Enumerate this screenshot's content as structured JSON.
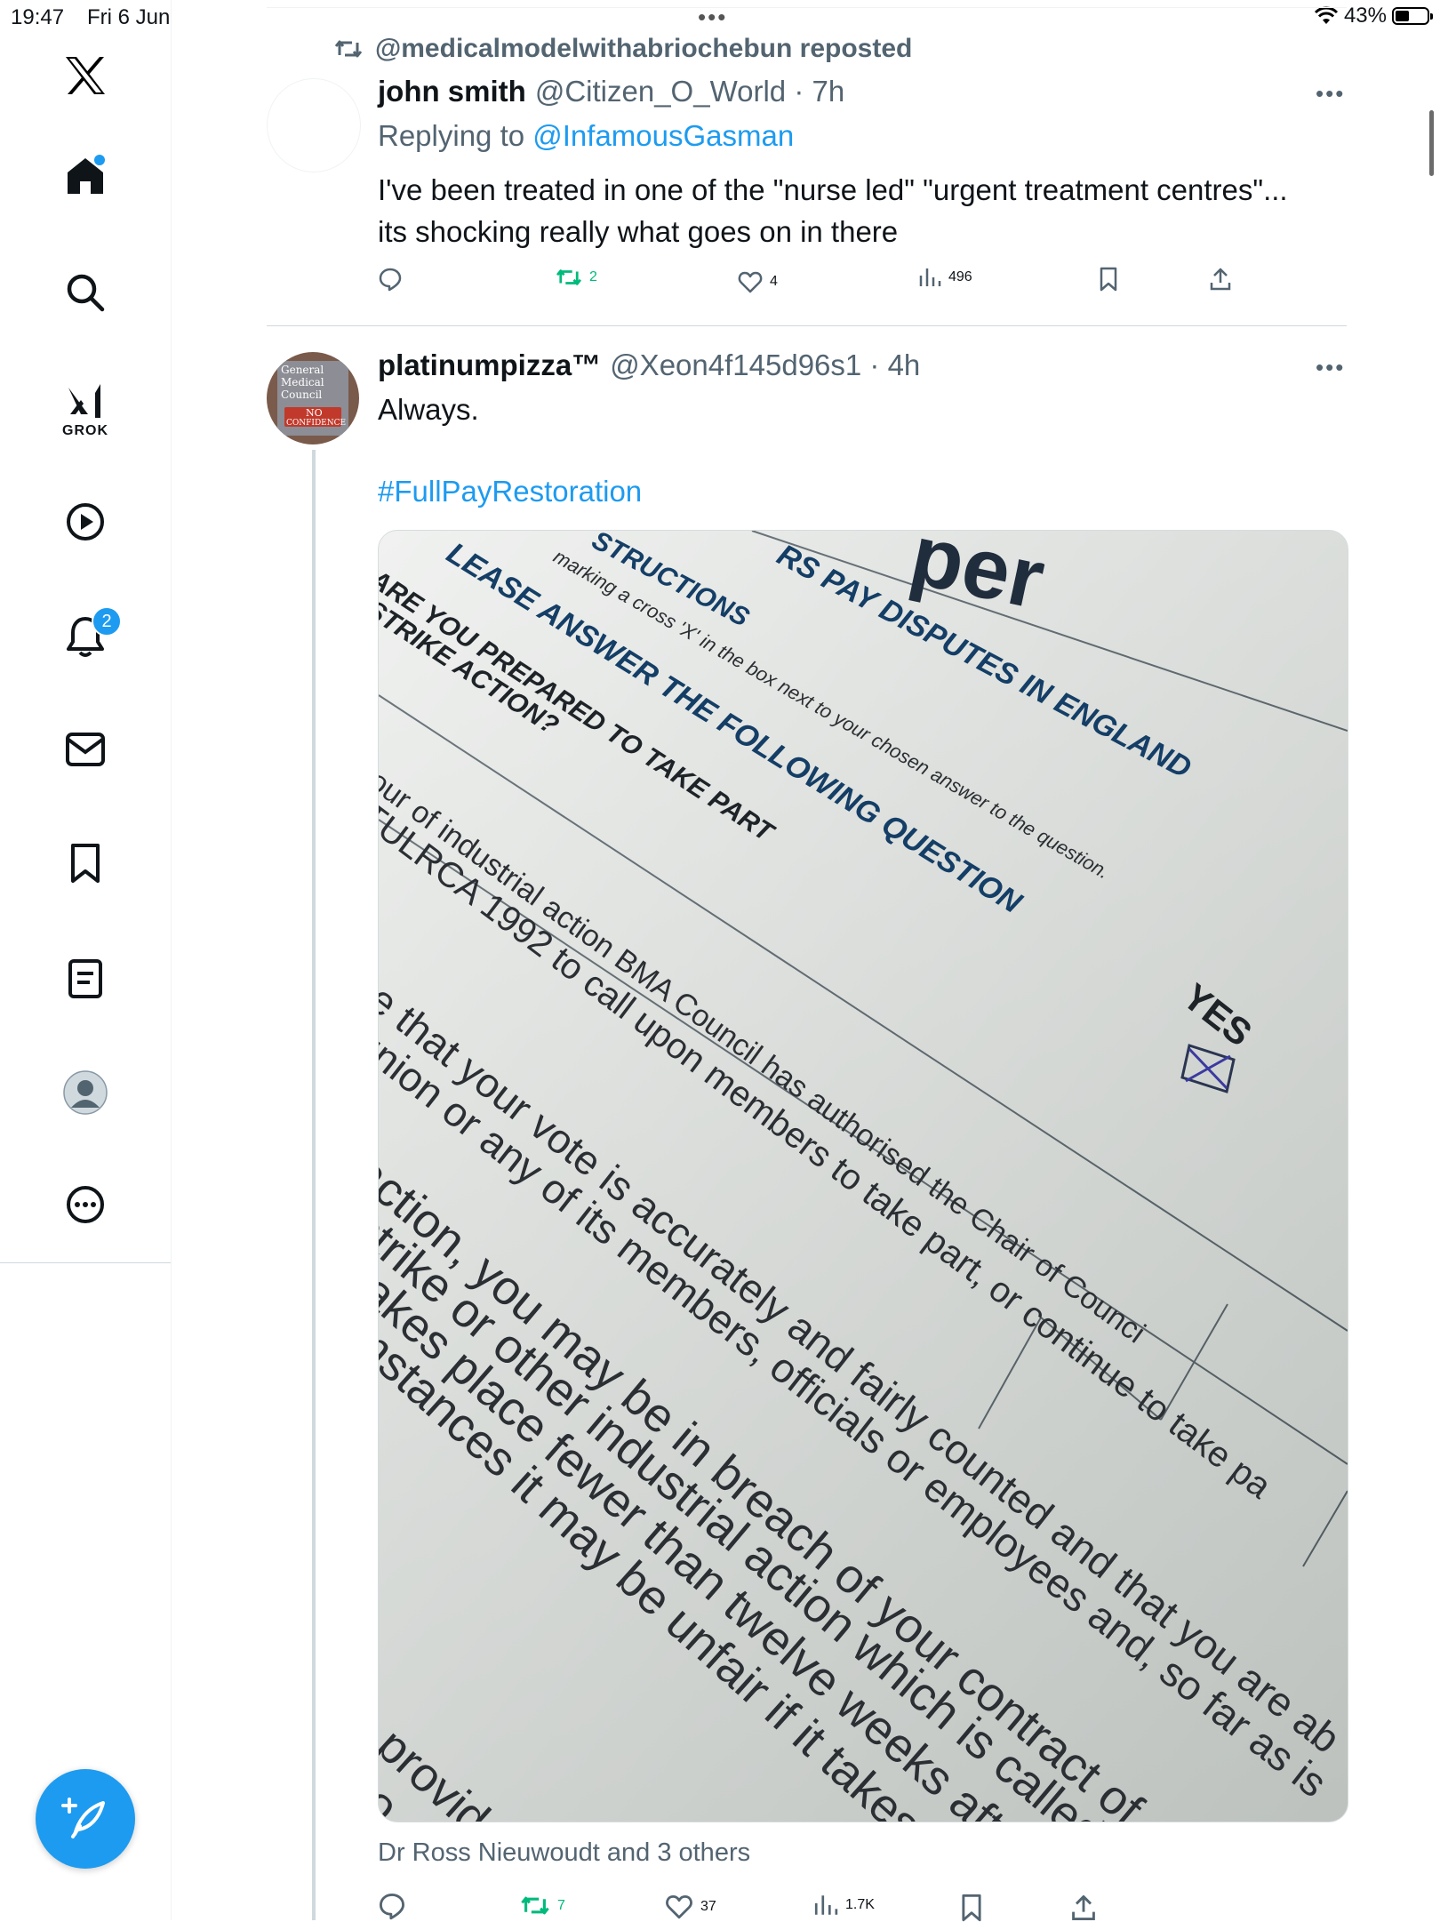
{
  "status_bar": {
    "time": "19:47",
    "date": "Fri 6 Jun",
    "battery": "43%",
    "battery_level": 0.43
  },
  "sidebar": {
    "items": [
      {
        "name": "home",
        "icon": "home-icon",
        "has_dot": true
      },
      {
        "name": "explore",
        "icon": "search-icon"
      },
      {
        "name": "grok",
        "icon": "grok-icon",
        "label": "GROK"
      },
      {
        "name": "videos",
        "icon": "play-icon"
      },
      {
        "name": "notifications",
        "icon": "bell-icon",
        "badge": "2"
      },
      {
        "name": "messages",
        "icon": "mail-icon"
      },
      {
        "name": "bookmarks",
        "icon": "bookmark-icon"
      },
      {
        "name": "lists",
        "icon": "list-icon"
      },
      {
        "name": "profile",
        "icon": "avatar-icon"
      },
      {
        "name": "more",
        "icon": "more-icon"
      }
    ],
    "compose_icon": "compose-icon"
  },
  "feed": {
    "reposted_by": "@medicalmodelwithabriochebun reposted",
    "tweet1": {
      "name": "john smith",
      "handle_time": "@Citizen_O_World · 7h",
      "replying_prefix": "Replying to ",
      "replying_to": "@InfamousGasman",
      "text_line1": "I've been treated in one of the \"nurse led\" \"urgent treatment centres\"...",
      "text_line2": "its shocking really what goes on in there",
      "reposts": "2",
      "likes": "4",
      "views": "496"
    },
    "tweet2": {
      "name": "platinumpizza™",
      "handle_time": "@Xeon4f145d96s1 · 4h",
      "text": "Always.",
      "hashtag": "#FullPayRestoration",
      "liked_by": "Dr Ross Nieuwoudt and 3 others",
      "reposts": "7",
      "likes": "37",
      "views": "1.7K",
      "avatar_text": [
        "General",
        "Medical",
        "Council",
        "NO",
        "CONFIDENCE"
      ],
      "photo_text": {
        "title": "per",
        "heading1": "RS PAY DISPUTES IN ENGLAND",
        "heading2": "STRUCTIONS",
        "instruction": "marking a cross 'X' in the box next to your chosen answer to the question.",
        "heading3": "LEASE ANSWER THE FOLLOWING QUESTION",
        "question1": "ARE YOU PREPARED TO TAKE PART",
        "question2": "STRIKE ACTION?",
        "yes": "YES",
        "para1": "our of industrial action BMA Council has authorised the Chair of Counci",
        "para2": "TULRCA 1992 to call upon members to take part, or continue to take pa",
        "para3": "re that your vote is accurately and fairly counted and that you are ab",
        "para4": "union or any of its members, officials or employees and, so far as is",
        "para5": "action, you may be in breach of your contract of employment",
        "para6": "strike or other industrial action which is called officially",
        "para7": "takes place fewer than twelve weeks after you st",
        "para8": "mstances it may be unfair if it takes place",
        "para9": "e provided",
        "para10": "Lo"
      }
    }
  },
  "colors": {
    "accent": "#1d9bf0",
    "repost_green": "#00ba7c",
    "muted": "#536471"
  }
}
